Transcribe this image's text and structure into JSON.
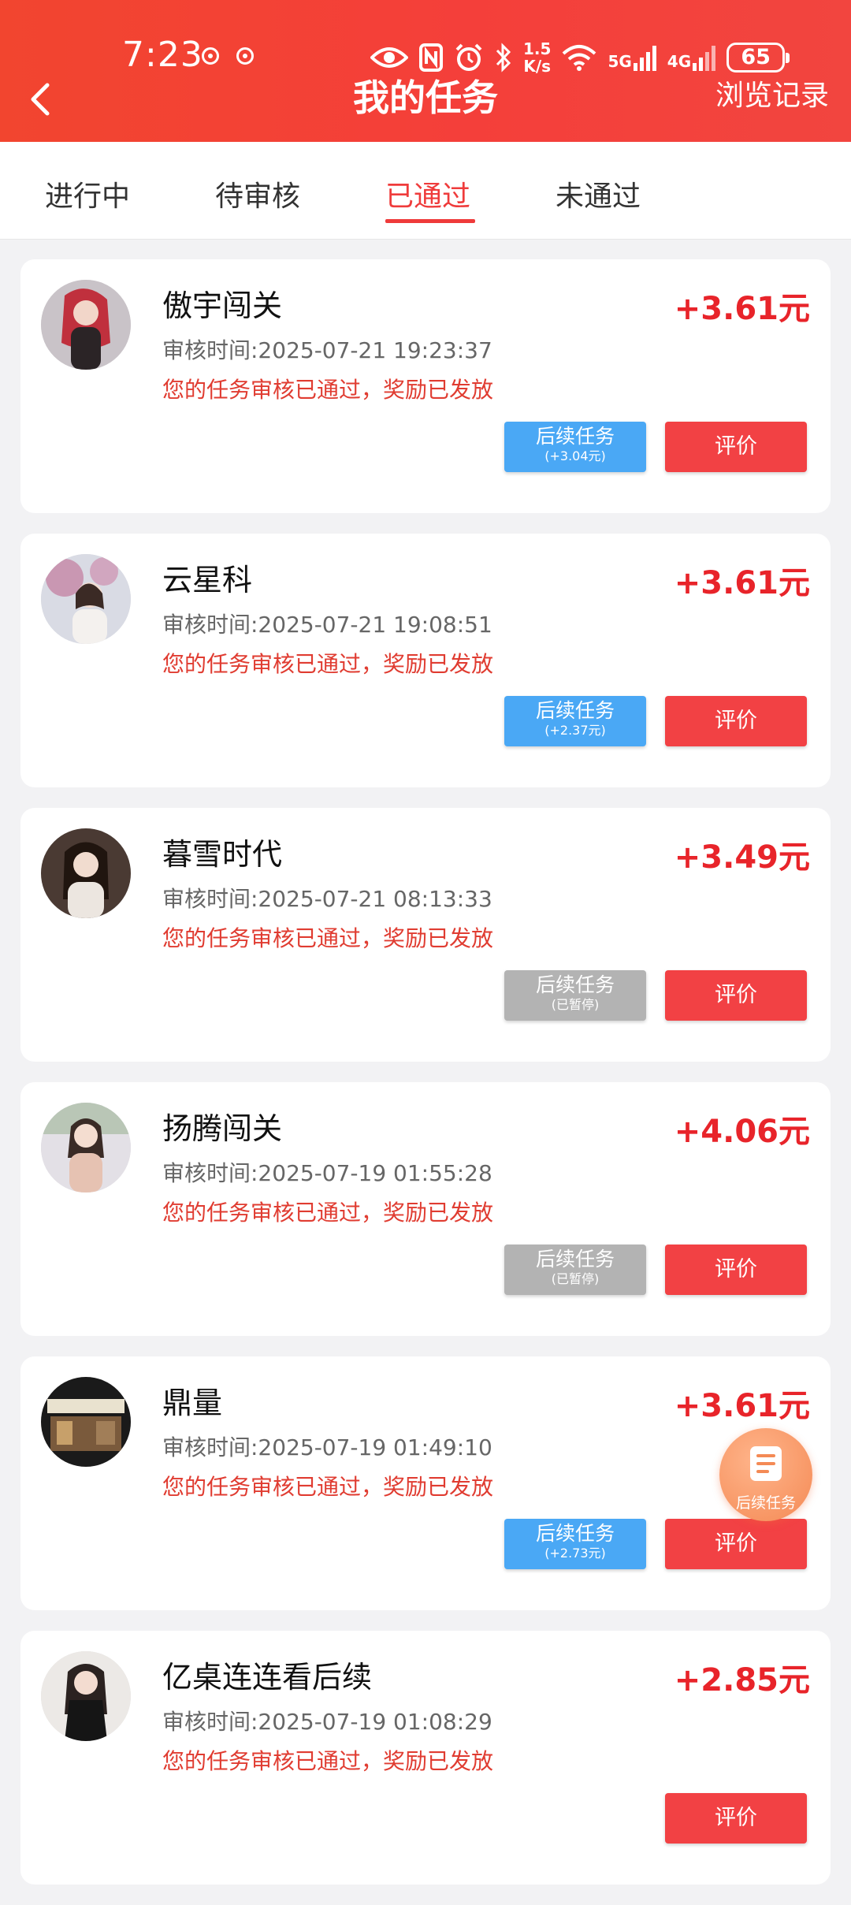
{
  "status_bar": {
    "time": "7:23",
    "net_speed_top": "1.5",
    "net_speed_bottom": "K/s",
    "net1": "5G",
    "net2": "4G",
    "battery": "65"
  },
  "nav": {
    "title": "我的任务",
    "history_label": "浏览记录"
  },
  "tabs": [
    {
      "label": "进行中"
    },
    {
      "label": "待审核"
    },
    {
      "label": "已通过"
    },
    {
      "label": "未通过"
    }
  ],
  "active_tab": "已通过",
  "tasks": [
    {
      "name": "傲宇闯关",
      "time": "审核时间:2025-07-21 19:23:37",
      "message": "您的任务审核已通过，奖励已发放",
      "amount": "+3.61元",
      "follow_label": "后续任务",
      "follow_sub": "(+3.04元)",
      "follow_state": "blue",
      "rate_label": "评价"
    },
    {
      "name": "云星科",
      "time": "审核时间:2025-07-21 19:08:51",
      "message": "您的任务审核已通过，奖励已发放",
      "amount": "+3.61元",
      "follow_label": "后续任务",
      "follow_sub": "(+2.37元)",
      "follow_state": "blue",
      "rate_label": "评价"
    },
    {
      "name": "暮雪时代",
      "time": "审核时间:2025-07-21 08:13:33",
      "message": "您的任务审核已通过，奖励已发放",
      "amount": "+3.49元",
      "follow_label": "后续任务",
      "follow_sub": "(已暂停)",
      "follow_state": "grey",
      "rate_label": "评价"
    },
    {
      "name": "扬腾闯关",
      "time": "审核时间:2025-07-19 01:55:28",
      "message": "您的任务审核已通过，奖励已发放",
      "amount": "+4.06元",
      "follow_label": "后续任务",
      "follow_sub": "(已暂停)",
      "follow_state": "grey",
      "rate_label": "评价"
    },
    {
      "name": "鼎量",
      "time": "审核时间:2025-07-19 01:49:10",
      "message": "您的任务审核已通过，奖励已发放",
      "amount": "+3.61元",
      "follow_label": "后续任务",
      "follow_sub": "(+2.73元)",
      "follow_state": "blue",
      "rate_label": "评价"
    },
    {
      "name": "亿桌连连看后续",
      "time": "审核时间:2025-07-19 01:08:29",
      "message": "您的任务审核已通过，奖励已发放",
      "amount": "+2.85元",
      "rate_label": "评价"
    }
  ],
  "float_button": {
    "label": "后续任务",
    "icon": "document-icon"
  },
  "colors": {
    "header": "#f2452f",
    "accent": "#ef3b3b",
    "amount": "#e8242a",
    "follow_blue": "#4aa8f5",
    "follow_grey": "#b3b3b3",
    "rate_red": "#f24144"
  }
}
